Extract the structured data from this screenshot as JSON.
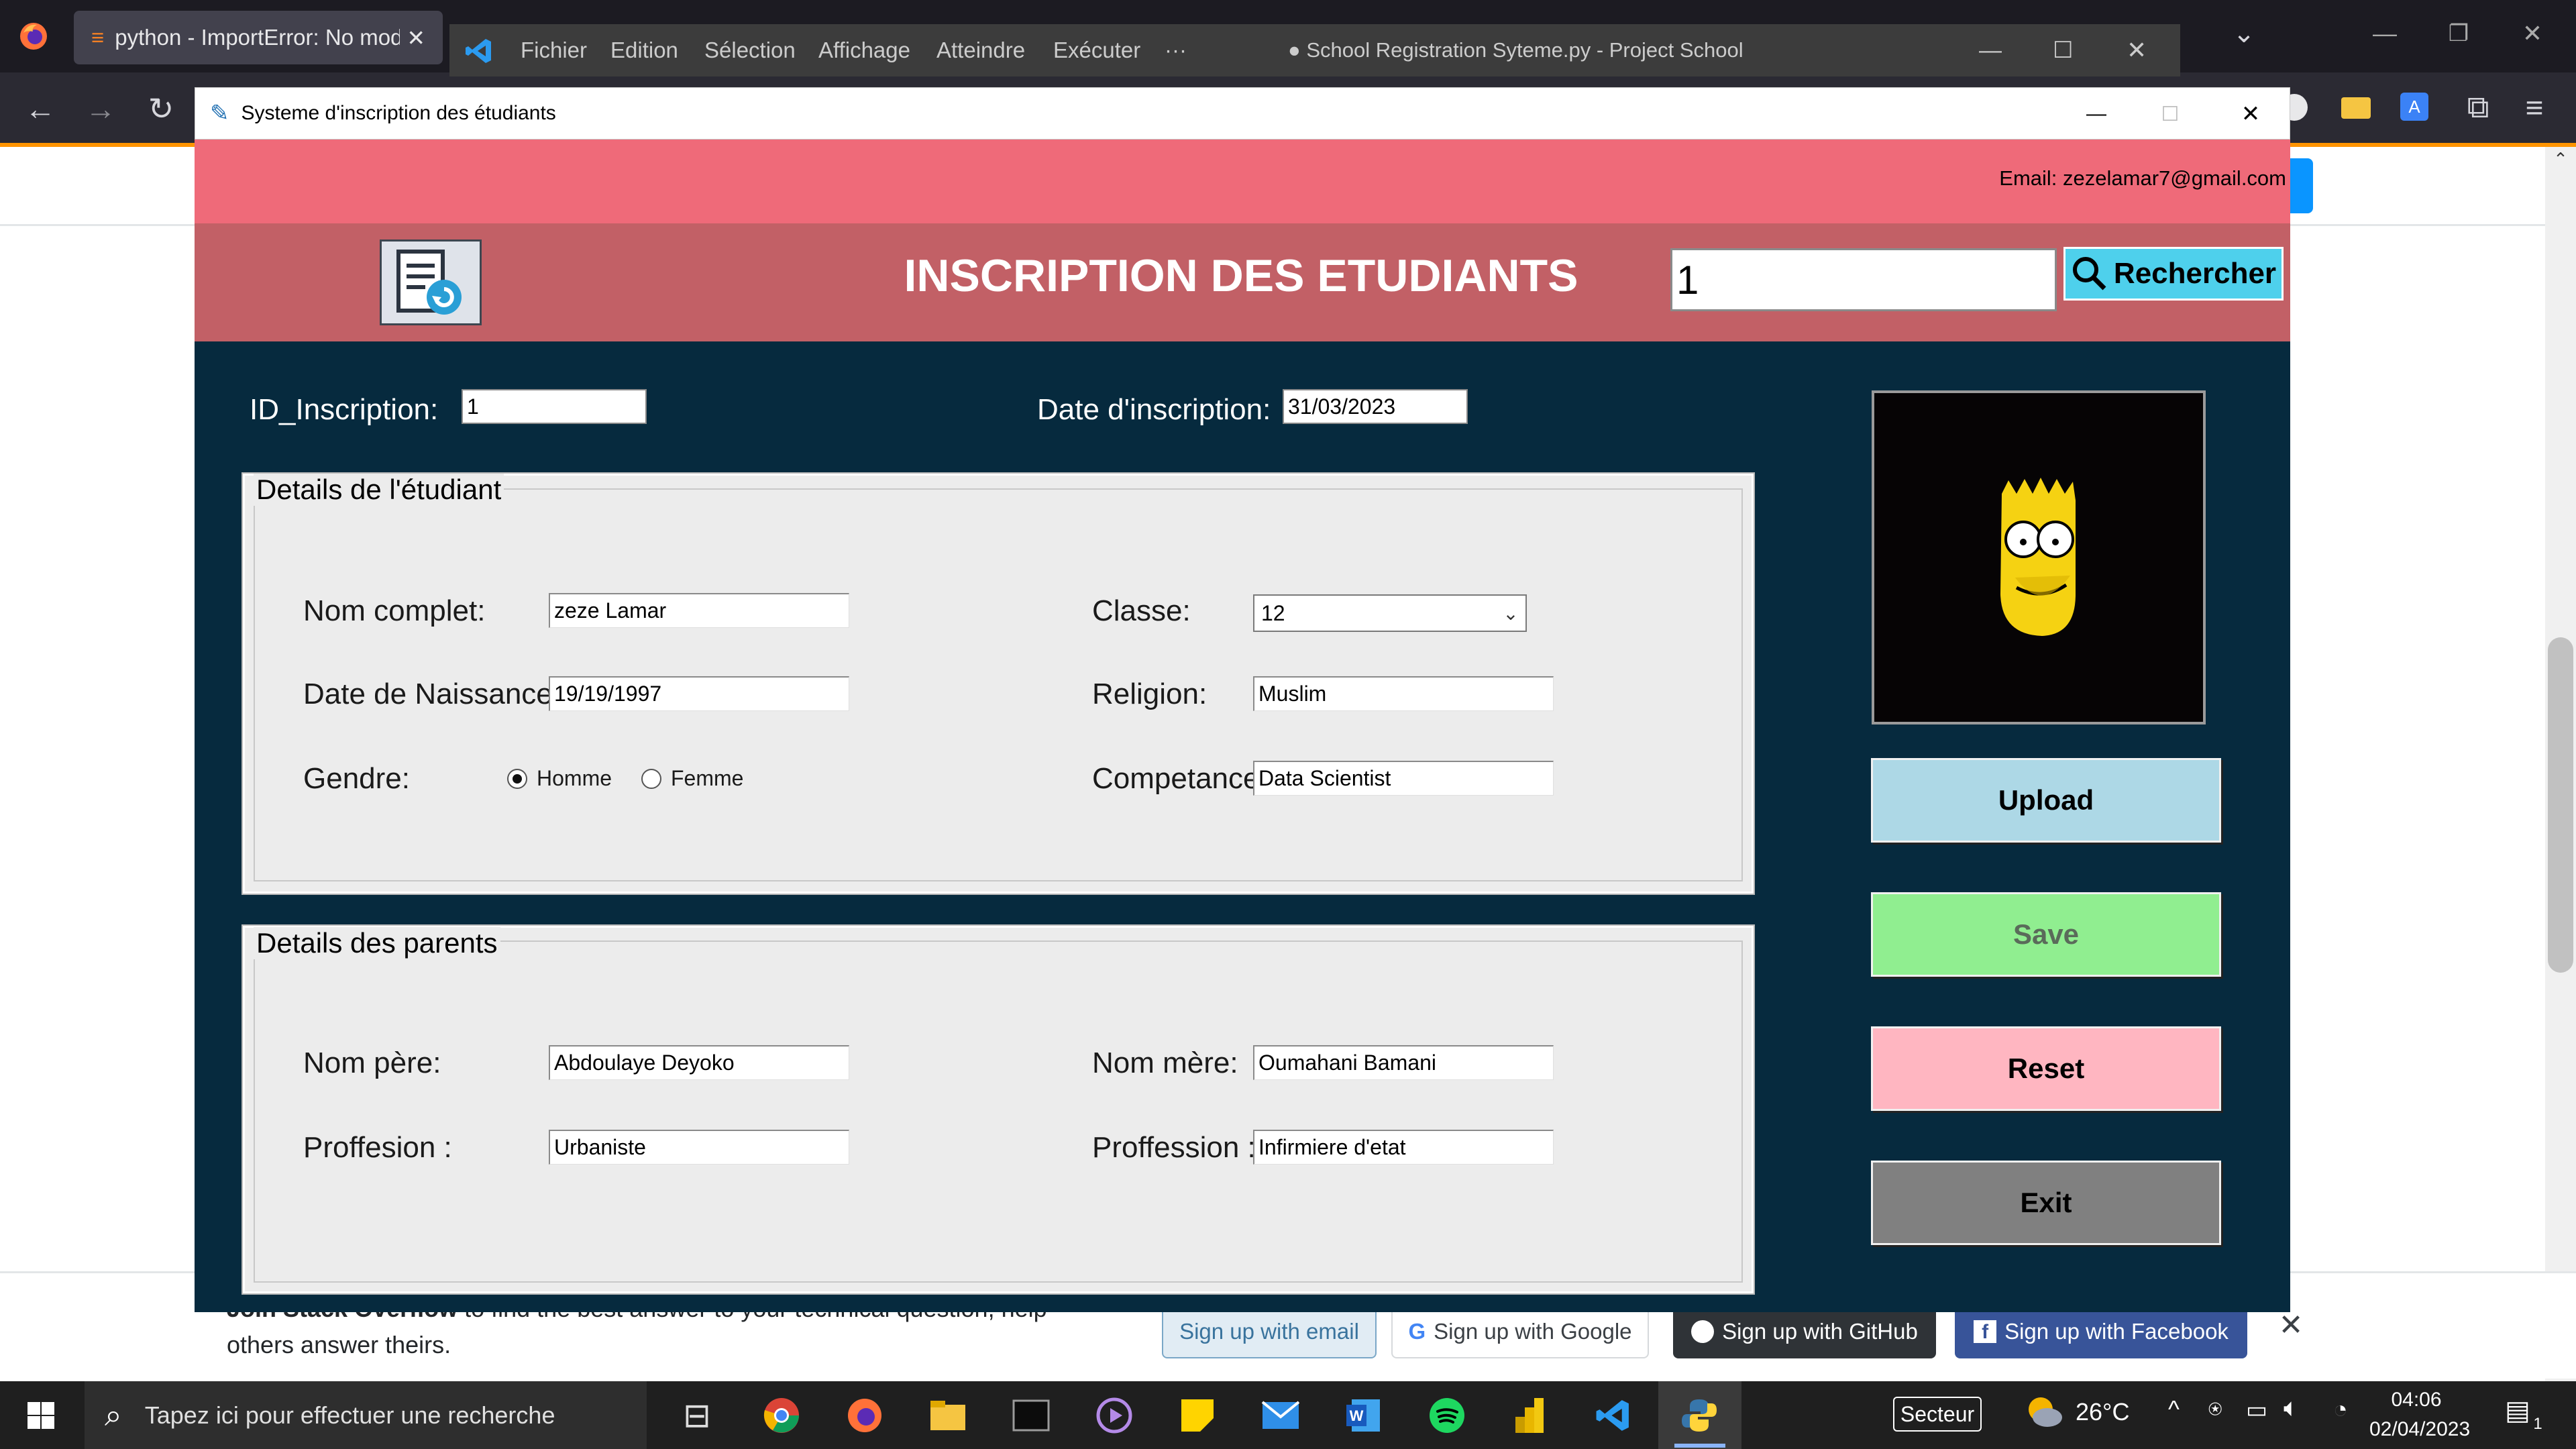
{
  "browser": {
    "tab_title": "python - ImportError: No modul",
    "close_glyph": "✕",
    "back_glyph": "←",
    "forward_glyph": "→",
    "reload_glyph": "↻"
  },
  "vscode": {
    "menus": [
      "Fichier",
      "Edition",
      "Sélection",
      "Affichage",
      "Atteindre",
      "Exécuter",
      "···"
    ],
    "title": "● School Registration Syteme.py - Project School Management - Visual S..."
  },
  "window": {
    "title": "Systeme d'inscription des étudiants",
    "minimize_glyph": "—",
    "maximize_glyph": "☐",
    "close_glyph": "✕"
  },
  "email_bar": {
    "text": "Email:  zezelamar7@gmail.com"
  },
  "header": {
    "title": "INSCRIPTION DES ETUDIANTS",
    "search_value": "1",
    "search_button": "Rechercher"
  },
  "top_fields": {
    "id_label": "ID_Inscription:",
    "id_value": "1",
    "date_label": "Date d'inscription:",
    "date_value": "31/03/2023"
  },
  "student_details": {
    "title": "Details de l'étudiant",
    "nom_label": "Nom complet:",
    "nom_value": "zeze Lamar",
    "naissance_label": "Date de Naissance:",
    "naissance_value": "19/19/1997",
    "genre_label": "Gendre:",
    "genre_options": [
      "Homme",
      "Femme"
    ],
    "genre_selected": "Homme",
    "classe_label": "Classe:",
    "classe_value": "12",
    "religion_label": "Religion:",
    "religion_value": "Muslim",
    "competence_label": "Competance:",
    "competence_value": "Data Scientist"
  },
  "parent_details": {
    "title": "Details des parents",
    "pere_label": "Nom père:",
    "pere_value": "Abdoulaye Deyoko",
    "pere_prof_label": "Proffesion :",
    "pere_prof_value": "Urbaniste",
    "mere_label": "Nom mère:",
    "mere_value": "Oumahani Bamani",
    "mere_prof_label": "Proffession :",
    "mere_prof_value": "Infirmiere d'etat"
  },
  "buttons": {
    "upload": "Upload",
    "save": "Save",
    "reset": "Reset",
    "exit": "Exit"
  },
  "colors": {
    "email_bar": "#ef6a79",
    "header": "#c26066",
    "body": "#062a3e",
    "upload": "#add8e6",
    "save": "#90ee90",
    "reset": "#ffb6c1",
    "exit": "#808080"
  },
  "stackoverflow_banner": {
    "text_bold": "Join Stack Overflow",
    "text_rest": " to find the best answer to your technical question, help",
    "text_line2": "others answer theirs.",
    "email_btn": "Sign up with email",
    "google_btn": "Sign up with Google",
    "github_btn": "Sign up with GitHub",
    "facebook_btn": "Sign up with Facebook"
  },
  "taskbar": {
    "search_placeholder": "Tapez ici pour effectuer une recherche",
    "secteur": "Secteur",
    "temperature": "26°C",
    "time": "04:06",
    "date": "02/04/2023",
    "notification_count": "1"
  }
}
